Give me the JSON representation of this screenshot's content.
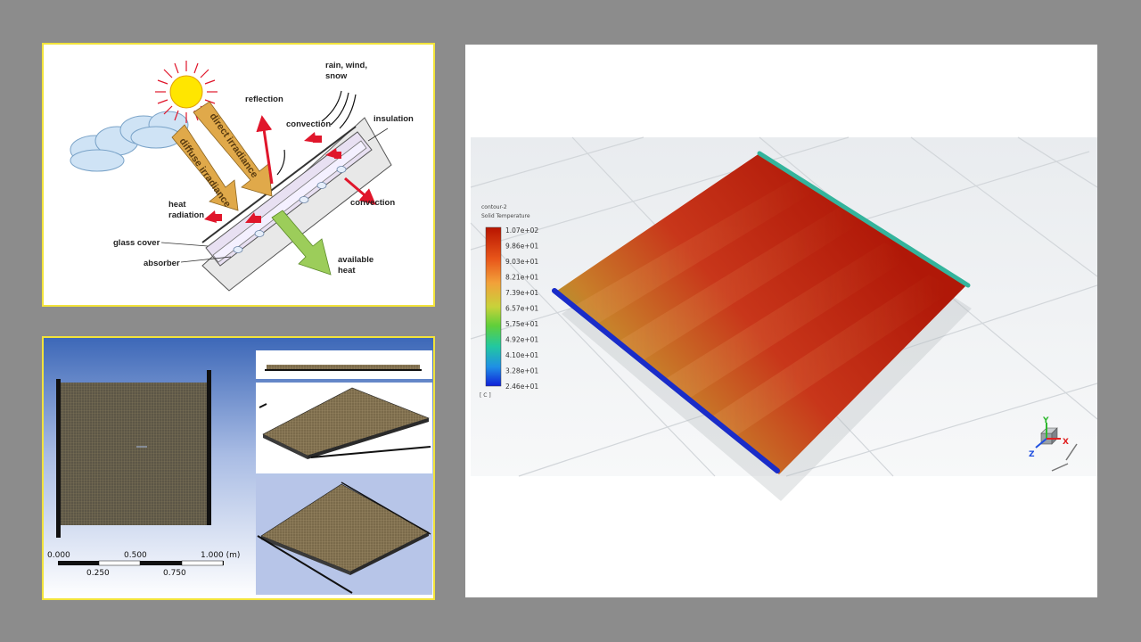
{
  "diagram": {
    "labels": {
      "rain": "rain, wind,",
      "snow": "snow",
      "reflection": "reflection",
      "insulation": "insulation",
      "convection_top": "convection",
      "convection_right": "convection",
      "heat1": "heat",
      "heat2": "radiation",
      "glass_cover": "glass cover",
      "absorber": "absorber",
      "available1": "available",
      "available2": "heat",
      "direct_irradiance": "direct irradiance",
      "diffuse_irradiance": "diffuse irradiance"
    },
    "colors": {
      "sun": "#ffe600",
      "irradiance": "#e0a94a",
      "loss_arrow": "#e0162b",
      "useful_arrow": "#9ccd5a"
    }
  },
  "mesh": {
    "scale": {
      "top_ticks": [
        "0.000",
        "0.500",
        "1.000 (m)"
      ],
      "bottom_ticks": [
        "0.250",
        "0.750"
      ]
    }
  },
  "contour": {
    "legend": {
      "title_line1": "contour-2",
      "title_line2": "Solid Temperature",
      "ticks": [
        "1.07e+02",
        "9.86e+01",
        "9.03e+01",
        "8.21e+01",
        "7.39e+01",
        "6.57e+01",
        "5.75e+01",
        "4.92e+01",
        "4.10e+01",
        "3.28e+01",
        "2.46e+01"
      ],
      "unit": "[ C ]"
    },
    "axes": {
      "x": "X",
      "y": "Y",
      "z": "Z"
    }
  }
}
